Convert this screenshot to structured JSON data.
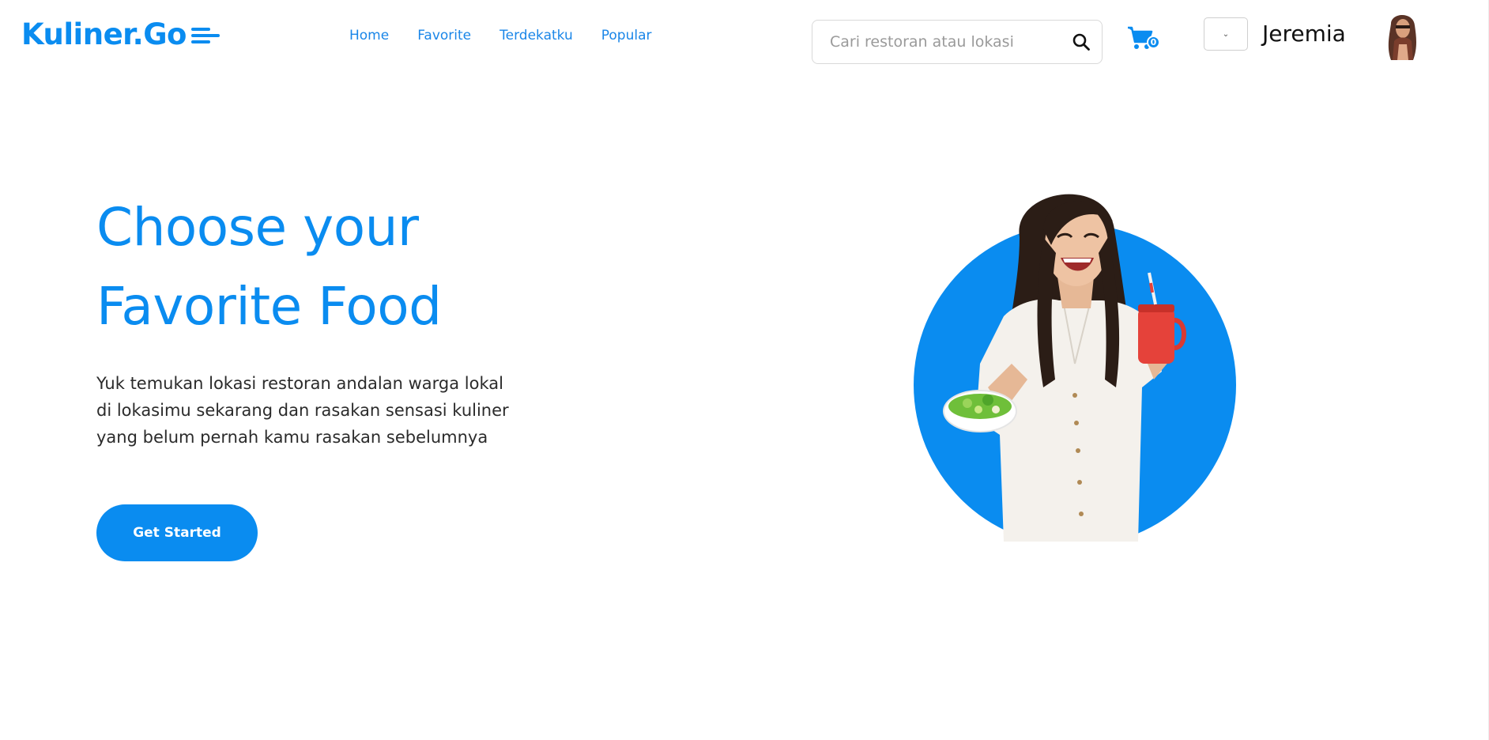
{
  "header": {
    "logo_text": "Kuliner.Go",
    "nav": [
      {
        "label": "Home"
      },
      {
        "label": "Favorite"
      },
      {
        "label": "Terdekatku"
      },
      {
        "label": "Popular"
      }
    ],
    "search": {
      "placeholder": "Cari restoran atau lokasi",
      "icon": "search-icon"
    },
    "cart": {
      "icon": "cart-icon",
      "count": "0"
    },
    "dropdown": {
      "icon": "chevron-down-icon"
    },
    "user": {
      "name": "Jeremia"
    }
  },
  "hero": {
    "title_line1": "Choose your",
    "title_line2": "Favorite Food",
    "desc_line1": "Yuk temukan lokasi restoran andalan warga lokal",
    "desc_line2": "di lokasimu sekarang dan rasakan sensasi kuliner",
    "desc_line3": "yang belum pernah kamu rasakan sebelumnya",
    "cta_label": "Get Started"
  },
  "colors": {
    "brand": "#0a8cf0",
    "text": "#2b2b2b"
  }
}
